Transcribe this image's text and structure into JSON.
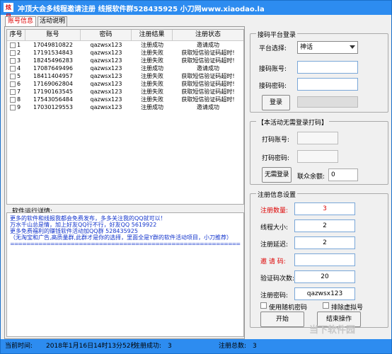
{
  "app": {
    "icon_text": "炫目",
    "title": "冲顶大会多线程邀请注册    线报软件群528435925    小刀网www.xiaodao.la"
  },
  "tabs": [
    "账号信息",
    "活动说明"
  ],
  "table": {
    "headers": [
      "序号",
      "账号",
      "密码",
      "注册结果",
      "注册状态"
    ],
    "rows": [
      [
        "1",
        "17049810822",
        "qazwsx123",
        "注册成功",
        "邀请成功"
      ],
      [
        "2",
        "17191534843",
        "qazwsx123",
        "注册失败",
        "获取短信验证码超时!"
      ],
      [
        "3",
        "18245496283",
        "qazwsx123",
        "注册失败",
        "获取短信验证码超时!"
      ],
      [
        "4",
        "17087649496",
        "qazwsx123",
        "注册成功",
        "邀请成功"
      ],
      [
        "5",
        "18411404957",
        "qazwsx123",
        "注册失败",
        "获取短信验证码超时!"
      ],
      [
        "6",
        "17169062804",
        "qazwsx123",
        "注册失败",
        "获取短信验证码超时!"
      ],
      [
        "7",
        "17190163545",
        "qazwsx123",
        "注册失败",
        "获取短信验证码超时!"
      ],
      [
        "8",
        "17543056484",
        "qazwsx123",
        "注册失败",
        "获取短信验证码超时!"
      ],
      [
        "9",
        "17030129553",
        "qazwsx123",
        "注册成功",
        "邀请成功"
      ]
    ]
  },
  "log": {
    "label": "软件运行详情:",
    "lines": [
      "更多的软件和线报我都会免费发布，多多关注我的QQ就可以！",
      "万水千山总是情，加上好友QQ行不行，好友QQ 5619922",
      "更多免费福利的赚钱软件活动加QQ群 528435925",
      "（无淘宝和广告,高质量群,此群才是你的选择，里面全是Y群的软件活动项目，小刀推荐）",
      "================================================================"
    ]
  },
  "platform": {
    "title": "接码平台登录",
    "select_label": "平台选择:",
    "select_value": "神话",
    "account_label": "接码账号:",
    "password_label": "接码密码:",
    "login_btn": "登录"
  },
  "nologin": {
    "title": "【本活动无需登录打码】",
    "account_label": "打码账号:",
    "password_label": "打码密码:",
    "btn": "无需登录",
    "balance_label": "联众余额:",
    "balance_value": "0"
  },
  "settings": {
    "title": "注册信息设置",
    "count_label": "注册数量:",
    "count_value": "3",
    "threads_label": "线程大小:",
    "threads_value": "2",
    "delay_label": "注册延迟:",
    "delay_value": "2",
    "invite_label": "邀 请 码:",
    "verify_label": "验证码次数:",
    "verify_value": "20",
    "pwd_label": "注册密码:",
    "pwd_value": "qazwsx123",
    "random_pwd": "使用随机密码",
    "exclude_virtual": "排除虚拟号",
    "start_btn": "开始",
    "stop_btn": "结束操作"
  },
  "status": {
    "time_label": "当前时间:",
    "time_value": "2018年1月16日14时13分52秒",
    "success_label": "注册成功:",
    "success_value": "3",
    "total_label": "注册总数:",
    "total_value": "3"
  },
  "watermark": "当下软件园",
  "colors": {
    "title_bar": "#2d8cf0",
    "red_label": "#dd0000",
    "log_text": "#1133cc"
  }
}
